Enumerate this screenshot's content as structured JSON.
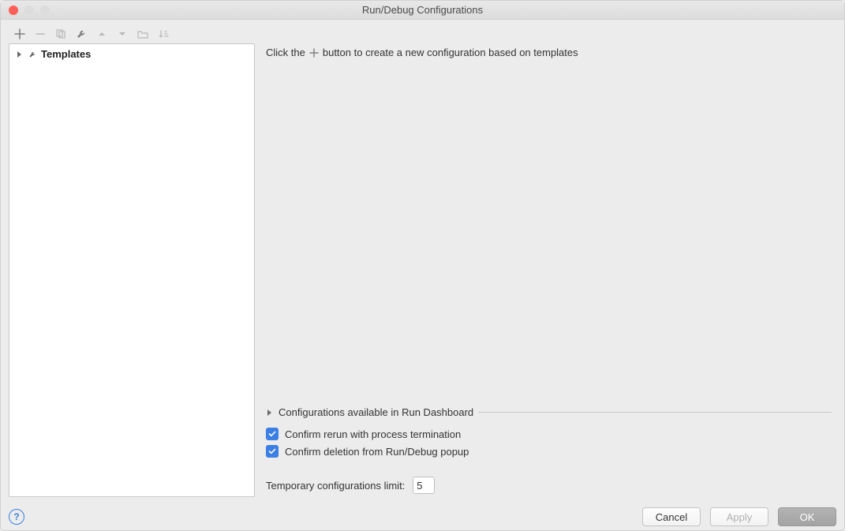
{
  "title": "Run/Debug Configurations",
  "sidebar": {
    "templates_label": "Templates"
  },
  "hint": {
    "prefix": "Click the",
    "suffix": "button to create a new configuration based on templates"
  },
  "dashboard": {
    "label": "Configurations available in Run Dashboard"
  },
  "options": {
    "confirm_rerun": {
      "label": "Confirm rerun with process termination",
      "checked": true
    },
    "confirm_delete": {
      "label": "Confirm deletion from Run/Debug popup",
      "checked": true
    }
  },
  "limit": {
    "label": "Temporary configurations limit:",
    "value": "5"
  },
  "buttons": {
    "cancel": "Cancel",
    "apply": "Apply",
    "ok": "OK"
  }
}
